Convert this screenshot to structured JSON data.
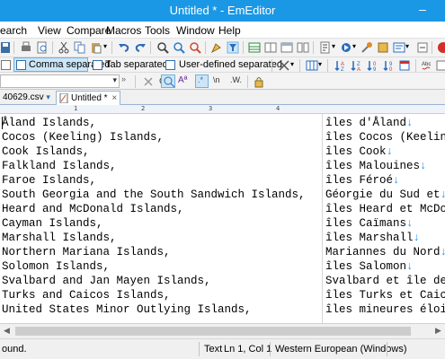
{
  "window": {
    "title": "Untitled * - EmEditor"
  },
  "menu": [
    "earch",
    "View",
    "Compare",
    "Macros",
    "Tools",
    "Window",
    "Help"
  ],
  "csv_toolbar": {
    "comma": "Comma separated",
    "tab": "Tab separated",
    "user": "User-defined separated"
  },
  "search_row": {
    "regex_label": ".*",
    "newline_label": "\\n",
    "word_label": ".W."
  },
  "tabs": [
    {
      "label": "40629.csv",
      "active": false
    },
    {
      "label": "Untitled *",
      "active": true
    }
  ],
  "ruler": {
    "marks": [
      "1",
      "2",
      "3",
      "4"
    ]
  },
  "editor": {
    "lines": [
      {
        "left": "Åland Islands,",
        "right": "îles d'Åland"
      },
      {
        "left": "Cocos (Keeling) Islands,",
        "right": "îles Cocos (Keelin"
      },
      {
        "left": "Cook Islands,",
        "right": "îles Cook"
      },
      {
        "left": "Falkland Islands,",
        "right": "îles Malouines"
      },
      {
        "left": "Faroe Islands,",
        "right": "îles Féroé"
      },
      {
        "left": "South Georgia and the South Sandwich Islands,",
        "right": "Géorgie du Sud et"
      },
      {
        "left": "Heard and McDonald Islands,",
        "right": "îles Heard et McDo"
      },
      {
        "left": "Cayman Islands,",
        "right": "îles Caïmans"
      },
      {
        "left": "Marshall Islands,",
        "right": "îles Marshall"
      },
      {
        "left": "Northern Mariana Islands,",
        "right": "Mariannes du Nord"
      },
      {
        "left": "Solomon Islands,",
        "right": "îles Salomon"
      },
      {
        "left": "Svalbard and Jan Mayen Islands,",
        "right": "Svalbard et île de"
      },
      {
        "left": "Turks and Caicos Islands,",
        "right": "îles Turks et Caic"
      },
      {
        "left": "United States Minor Outlying Islands,",
        "right": "îles mineures éloi"
      }
    ],
    "eol_marker": "↓"
  },
  "status": {
    "message": "ound.",
    "mode": "Text",
    "position": "Ln 1, Col 1",
    "encoding": "Western European (Windows)"
  },
  "colors": {
    "titlebar": "#1a98e6",
    "eol": "#1e90ff"
  }
}
